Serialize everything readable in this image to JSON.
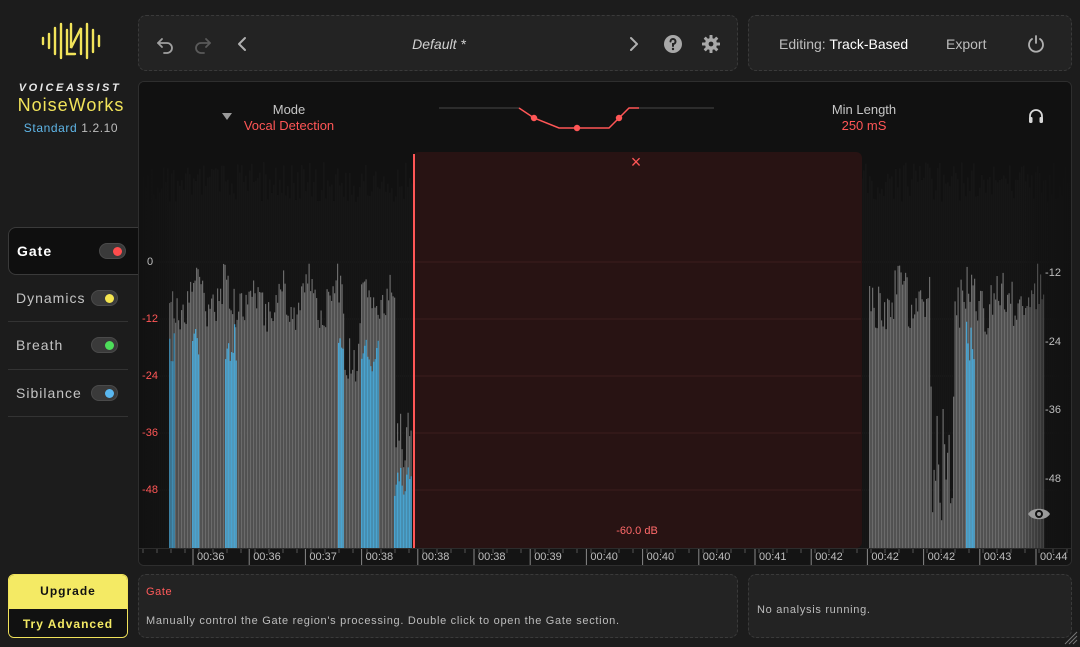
{
  "brand": {
    "company": "VOICEASSIST",
    "product": "NoiseWorks",
    "tier": "Standard",
    "version": "1.2.10"
  },
  "nav": {
    "items": [
      {
        "label": "Gate",
        "color": "#ff4d4d",
        "active": true
      },
      {
        "label": "Dynamics",
        "color": "#f5e650",
        "active": false
      },
      {
        "label": "Breath",
        "color": "#4dde5a",
        "active": false
      },
      {
        "label": "Sibilance",
        "color": "#5ab8f0",
        "active": false
      }
    ]
  },
  "upgrade": {
    "top": "Upgrade",
    "bottom": "Try Advanced"
  },
  "toolbar": {
    "preset": "Default *",
    "undo_icon": "undo-icon",
    "redo_icon": "redo-icon",
    "prev_icon": "chevron-left-icon",
    "next_icon": "chevron-right-icon",
    "help_icon": "help-icon",
    "settings_icon": "gear-icon"
  },
  "editing": {
    "label": "Editing:",
    "value": "Track-Based",
    "export": "Export"
  },
  "controls": {
    "mode_label": "Mode",
    "mode_value": "Vocal Detection",
    "min_length_label": "Min Length",
    "min_length_value": "250 mS"
  },
  "waveform": {
    "db_left": [
      "0",
      "-12",
      "-24",
      "-36",
      "-48"
    ],
    "db_right": [
      "-12",
      "-24",
      "-36",
      "-48"
    ],
    "gate_threshold": "-60.0 dB",
    "timeline": [
      "00:36",
      "00:36",
      "00:37",
      "00:38",
      "00:38",
      "00:38",
      "00:39",
      "00:40",
      "00:40",
      "00:40",
      "00:41",
      "00:42",
      "00:42",
      "00:42",
      "00:43",
      "00:44"
    ]
  },
  "info": {
    "title": "Gate",
    "text": "Manually control the Gate region's processing. Double click to open the Gate section.",
    "status": "No analysis running."
  },
  "colors": {
    "accent": "#ff5656",
    "brand_yellow": "#f4ea64",
    "wave_gray": "#6b6b6b",
    "wave_blue": "#4aa3cf",
    "gate_fill": "#2a1414"
  }
}
